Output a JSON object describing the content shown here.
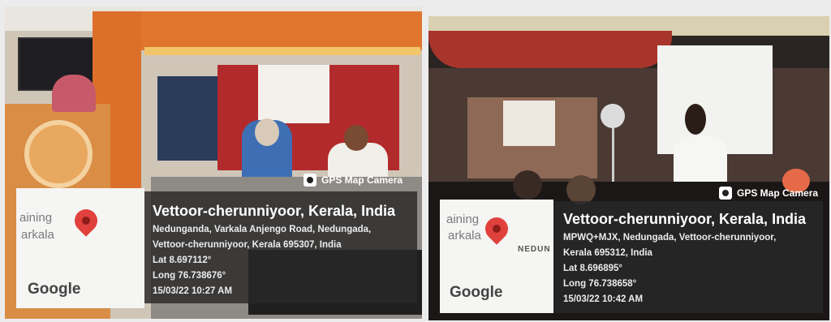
{
  "photo_left": {
    "tag": "GPS Map Camera",
    "map_text": [
      "aining",
      "arkala"
    ],
    "map_brand": "Google",
    "title": "Vettoor-cherunniyoor, Kerala, India",
    "address_lines": [
      "Nedunganda, Varkala Anjengo Road, Nedungada,",
      "Vettoor-cherunniyoor, Kerala 695307, India"
    ],
    "lat": "Lat 8.697112°",
    "long": "Long 76.738676°",
    "datetime": "15/03/22 10:27 AM"
  },
  "photo_right": {
    "tag": "GPS Map Camera",
    "map_text": [
      "aining",
      "arkala"
    ],
    "map_place": "NEDUN",
    "map_brand": "Google",
    "title": "Vettoor-cherunniyoor, Kerala, India",
    "address_lines": [
      "MPWQ+MJX, Nedungada, Vettoor-cherunniyoor,",
      "Kerala 695312, India"
    ],
    "lat": "Lat 8.696895°",
    "long": "Long 76.738658°",
    "datetime": "15/03/22 10:42 AM"
  },
  "colors": {
    "curtain": "#e0762e",
    "wall_red": "#b22a2b",
    "overlay": "#282828",
    "pin": "#e0413d"
  }
}
